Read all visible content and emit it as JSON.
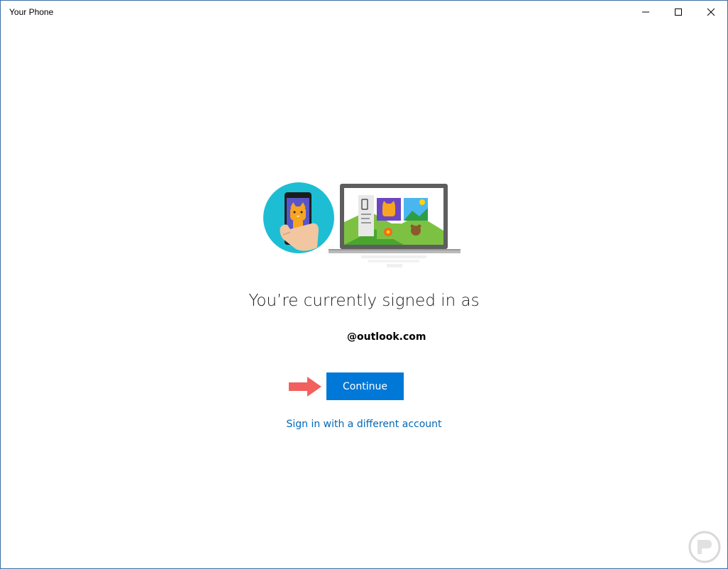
{
  "window": {
    "title": "Your Phone",
    "controls": [
      "minimize-icon",
      "maximize-icon",
      "close-icon"
    ]
  },
  "main": {
    "heading": "You’re currently signed in as",
    "account": "@outlook.com",
    "continue_label": "Continue",
    "alt_link": "Sign in with a different account"
  },
  "colors": {
    "accent": "#0078d7",
    "link": "#0067b8",
    "arrow": "#f25f5c",
    "illustration_circle": "#1dbed3"
  },
  "icons": {
    "illustration": "phone-and-laptop-illustration",
    "pointer": "arrow-right-icon",
    "watermark": "watermark-logo"
  }
}
